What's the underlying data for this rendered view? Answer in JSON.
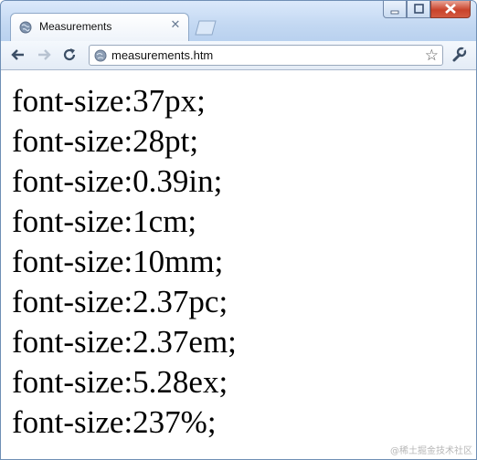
{
  "tab": {
    "title": "Measurements"
  },
  "address_bar": {
    "url": "measurements.htm"
  },
  "content": {
    "lines": [
      "font-size:37px;",
      "font-size:28pt;",
      "font-size:0.39in;",
      "font-size:1cm;",
      "font-size:10mm;",
      "font-size:2.37pc;",
      "font-size:2.37em;",
      "font-size:5.28ex;",
      "font-size:237%;"
    ]
  },
  "watermark": "@稀土掘金技术社区"
}
